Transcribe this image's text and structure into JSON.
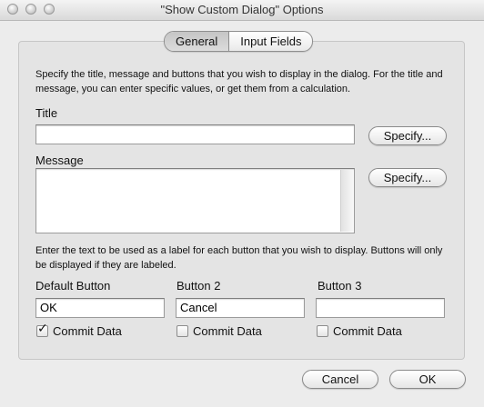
{
  "window": {
    "title": "\"Show Custom Dialog\" Options"
  },
  "tabs": [
    {
      "label": "General",
      "selected": true
    },
    {
      "label": "Input Fields",
      "selected": false
    }
  ],
  "general": {
    "intro": "Specify the title, message and buttons that you wish to display in the dialog. For the title and message, you can enter specific values, or get them from a calculation.",
    "title_label": "Title",
    "title_value": "",
    "message_label": "Message",
    "message_value": "",
    "specify_label": "Specify...",
    "buttons_intro": "Enter the text to be used as a label for each button that you wish to display. Buttons will only be displayed if they are labeled.",
    "buttons": [
      {
        "label": "Default Button",
        "value": "OK",
        "commit_label": "Commit Data",
        "commit_checked": true
      },
      {
        "label": "Button 2",
        "value": "Cancel",
        "commit_label": "Commit Data",
        "commit_checked": false
      },
      {
        "label": "Button 3",
        "value": "",
        "commit_label": "Commit Data",
        "commit_checked": false
      }
    ]
  },
  "footer": {
    "cancel_label": "Cancel",
    "ok_label": "OK"
  }
}
